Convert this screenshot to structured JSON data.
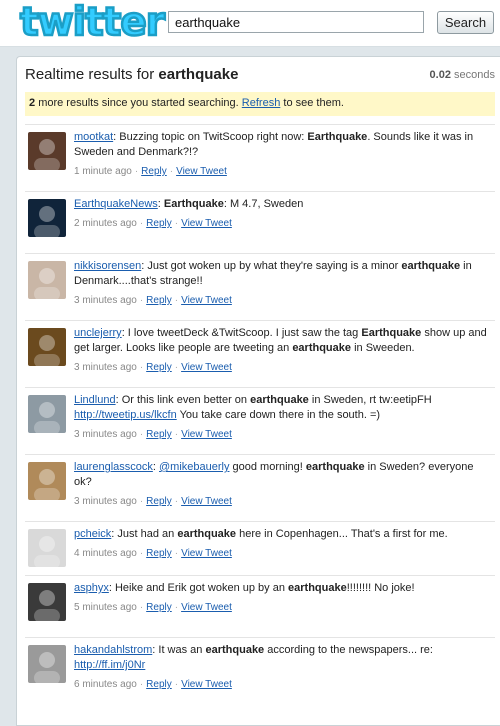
{
  "header": {
    "logo_text": "twitter",
    "search_value": "earthquake",
    "search_button": "Search"
  },
  "results": {
    "title_prefix": "Realtime results for",
    "query": "earthquake",
    "time_value": "0.02",
    "time_unit": "seconds"
  },
  "notice": {
    "count": "2",
    "text_before": "more results since you started searching.",
    "refresh_label": "Refresh",
    "text_after": "to see them."
  },
  "tweets": [
    {
      "user": "mootkat",
      "segments": [
        ": Buzzing topic on TwitScoop right now: ",
        {
          "b": "Earthquake"
        },
        ". Sounds like it was in Sweden and Denmark?!?"
      ],
      "time": "1 minute ago",
      "reply": "Reply",
      "view": "View Tweet",
      "avatar_color": "#5a3a2a"
    },
    {
      "user": "EarthquakeNews",
      "segments": [
        ": ",
        {
          "b": "Earthquake"
        },
        ": M 4.7, Sweden"
      ],
      "time": "2 minutes ago",
      "reply": "Reply",
      "view": "View Tweet",
      "avatar_color": "#10243a"
    },
    {
      "user": "nikkisorensen",
      "segments": [
        ": Just got woken up by what they're saying is a minor ",
        {
          "b": "earthquake"
        },
        " in Denmark....that's strange!!"
      ],
      "time": "3 minutes ago",
      "reply": "Reply",
      "view": "View Tweet",
      "avatar_color": "#c9b6a6"
    },
    {
      "user": "unclejerry",
      "segments": [
        ": I love tweetDeck &TwitScoop. I just saw the tag ",
        {
          "b": "Earthquake"
        },
        " show up and get larger. Looks like people are tweeting an ",
        {
          "b": "earthquake"
        },
        " in Sweeden."
      ],
      "time": "3 minutes ago",
      "reply": "Reply",
      "view": "View Tweet",
      "avatar_color": "#6b4a1e"
    },
    {
      "user": "Lindlund",
      "segments": [
        ": Or this link even better on ",
        {
          "b": "earthquake"
        },
        " in Sweden, rt tw:eetipFH ",
        {
          "link": "http://tweetip.us/lkcfn"
        },
        " You take care down there in the south. =)"
      ],
      "time": "3 minutes ago",
      "reply": "Reply",
      "view": "View Tweet",
      "avatar_color": "#8d9aa3"
    },
    {
      "user": "laurenglasscock",
      "segments": [
        ": ",
        {
          "link": "@mikebauerly"
        },
        " good morning! ",
        {
          "b": "earthquake"
        },
        " in Sweden? everyone ok?"
      ],
      "time": "3 minutes ago",
      "reply": "Reply",
      "view": "View Tweet",
      "avatar_color": "#b08a5a"
    },
    {
      "user": "pcheick",
      "segments": [
        ": Just had an ",
        {
          "b": "earthquake"
        },
        " here in Copenhagen... That's a first for me."
      ],
      "time": "4 minutes ago",
      "reply": "Reply",
      "view": "View Tweet",
      "avatar_color": "#d9d9d9"
    },
    {
      "user": "asphyx",
      "segments": [
        ": Heike and Erik got woken up by an ",
        {
          "b": "earthquake"
        },
        "!!!!!!!! No joke!"
      ],
      "time": "5 minutes ago",
      "reply": "Reply",
      "view": "View Tweet",
      "avatar_color": "#3a3a3a"
    },
    {
      "user": "hakandahlstrom",
      "segments": [
        ": It was an ",
        {
          "b": "earthquake"
        },
        " according to the newspapers... re: ",
        {
          "link": "http://ff.im/j0Nr"
        }
      ],
      "time": "6 minutes ago",
      "reply": "Reply",
      "view": "View Tweet",
      "avatar_color": "#9a9a9a"
    }
  ]
}
